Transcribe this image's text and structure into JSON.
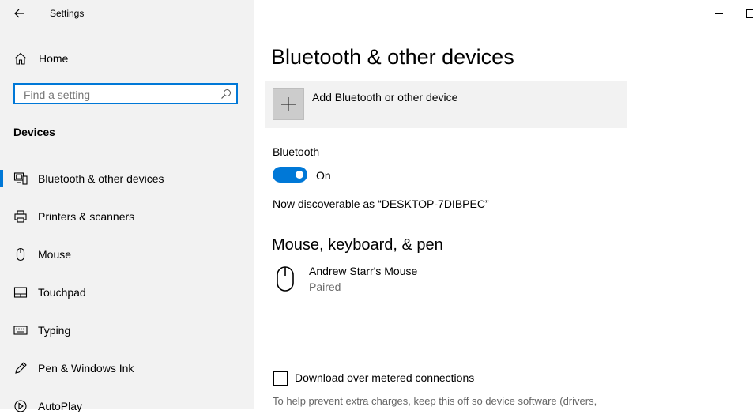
{
  "window": {
    "title": "Settings"
  },
  "sidebar": {
    "home_label": "Home",
    "search_placeholder": "Find a setting",
    "section_title": "Devices",
    "items": [
      {
        "label": "Bluetooth & other devices",
        "icon": "bluetooth-devices-icon",
        "selected": true
      },
      {
        "label": "Printers & scanners",
        "icon": "printer-icon",
        "selected": false
      },
      {
        "label": "Mouse",
        "icon": "mouse-icon",
        "selected": false
      },
      {
        "label": "Touchpad",
        "icon": "touchpad-icon",
        "selected": false
      },
      {
        "label": "Typing",
        "icon": "keyboard-icon",
        "selected": false
      },
      {
        "label": "Pen & Windows Ink",
        "icon": "pen-icon",
        "selected": false
      },
      {
        "label": "AutoPlay",
        "icon": "autoplay-icon",
        "selected": false
      }
    ]
  },
  "main": {
    "title": "Bluetooth & other devices",
    "add_device_label": "Add Bluetooth or other device",
    "bluetooth_label": "Bluetooth",
    "bluetooth_state": "On",
    "discoverable_text": "Now discoverable as “DESKTOP-7DIBPEC”",
    "mouse_section_title": "Mouse, keyboard, & pen",
    "device": {
      "name": "Andrew Starr's Mouse",
      "status": "Paired"
    },
    "metered_label": "Download over metered connections",
    "metered_checked": false,
    "help_text": "To help prevent extra charges, keep this off so device software (drivers,"
  },
  "colors": {
    "accent": "#0078d7",
    "sidebar_bg": "#f2f2f2",
    "secondary_text": "#6b6b6b"
  }
}
